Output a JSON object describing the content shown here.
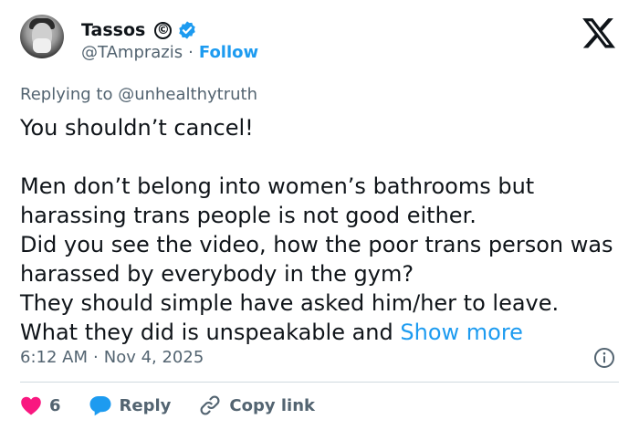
{
  "author": {
    "name": "Tassos",
    "handle": "@TAmprazis",
    "separator": "·",
    "follow_label": "Follow",
    "copyright_symbol": "©"
  },
  "reply_context": {
    "prefix": "Replying to ",
    "mention": "@unhealthytruth"
  },
  "tweet": {
    "text": "You shouldn’t cancel!\n\nMen don’t belong into women’s bathrooms but harassing trans people is not good either.\nDid you see the video, how the poor trans person was harassed by everybody in the gym?\nThey should simple have asked him/her to leave.\nWhat they did is unspeakable and ",
    "show_more_label": "Show more"
  },
  "meta": {
    "time": "6:12 AM",
    "separator": "·",
    "date": "Nov 4, 2025"
  },
  "actions": {
    "like_count": "6",
    "reply_label": "Reply",
    "copy_link_label": "Copy link"
  },
  "colors": {
    "accent": "#1d9bf0",
    "like": "#f91880",
    "muted": "#536471",
    "text": "#0f1419"
  },
  "icons": [
    "x-logo-icon",
    "verified-badge-icon",
    "info-icon",
    "heart-icon",
    "reply-bubble-icon",
    "link-icon"
  ]
}
